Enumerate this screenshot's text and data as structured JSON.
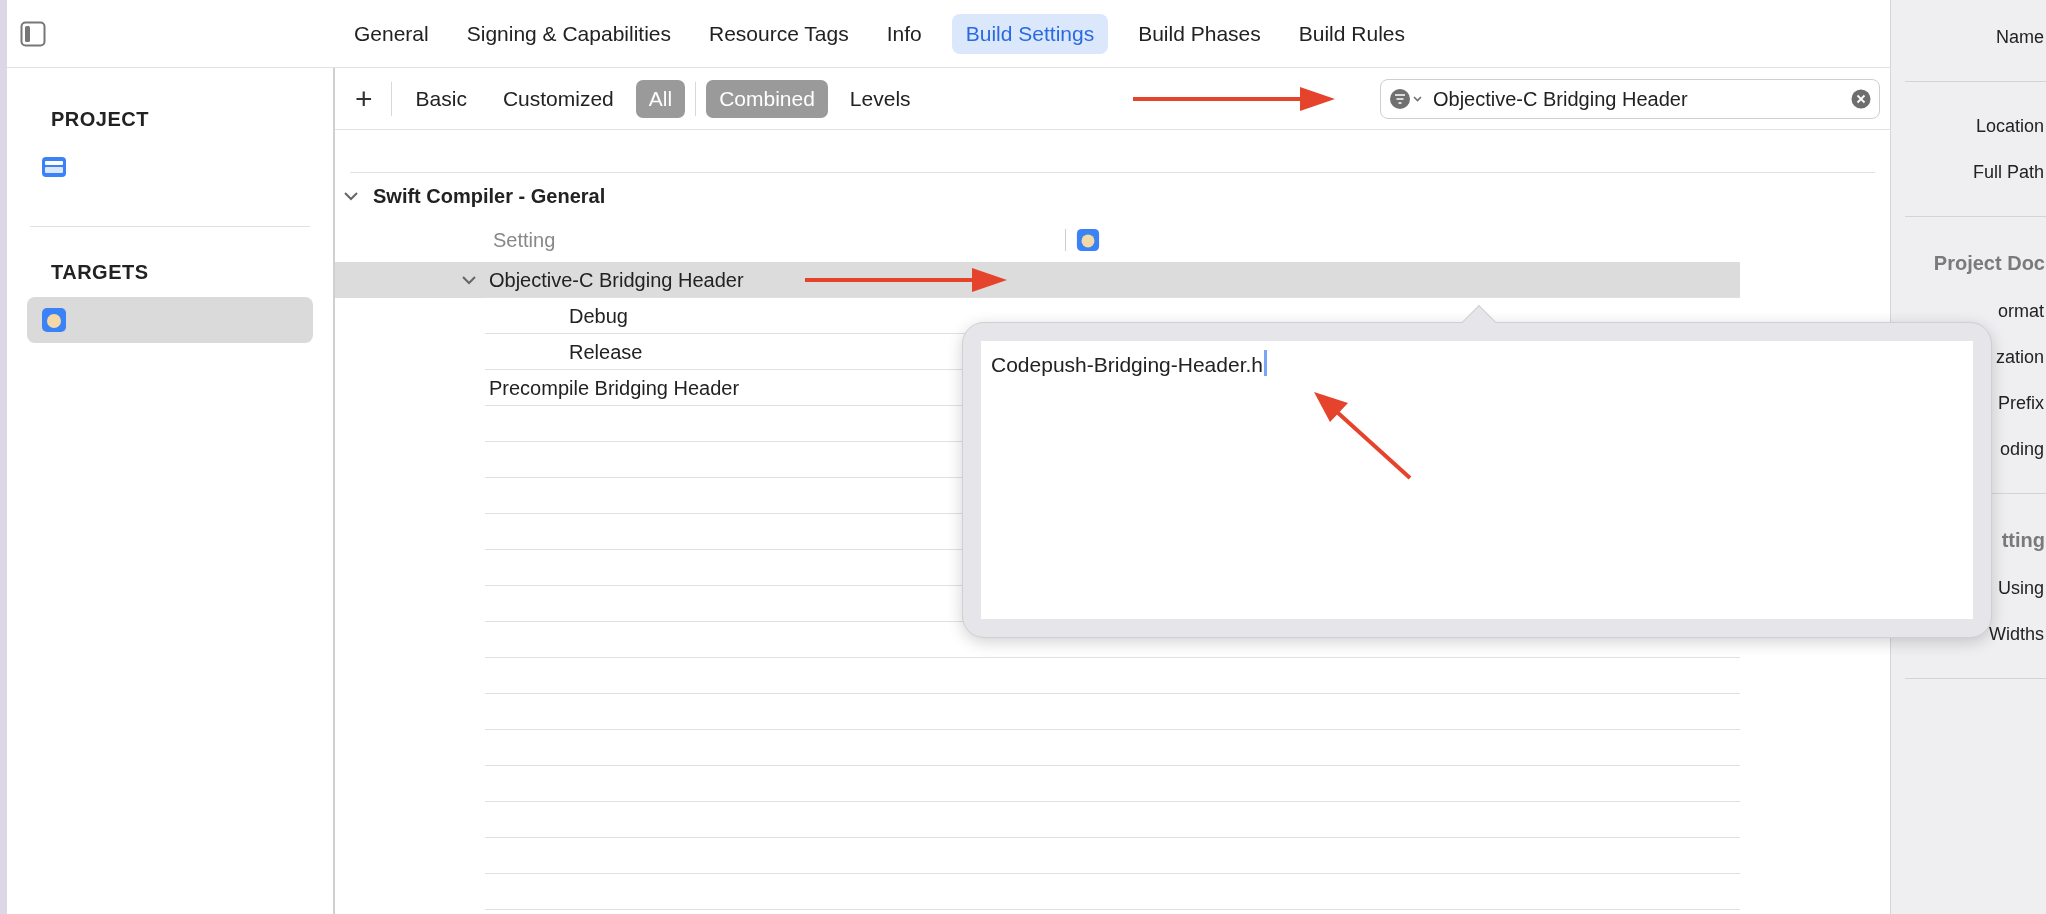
{
  "tabs": [
    {
      "label": "General",
      "selected": false
    },
    {
      "label": "Signing & Capabilities",
      "selected": false
    },
    {
      "label": "Resource Tags",
      "selected": false
    },
    {
      "label": "Info",
      "selected": false
    },
    {
      "label": "Build Settings",
      "selected": true
    },
    {
      "label": "Build Phases",
      "selected": false
    },
    {
      "label": "Build Rules",
      "selected": false
    }
  ],
  "sidebar": {
    "sections": [
      {
        "title": "PROJECT",
        "items": [
          {
            "kind": "project",
            "selected": false
          }
        ]
      },
      {
        "title": "TARGETS",
        "items": [
          {
            "kind": "app",
            "selected": true
          }
        ]
      }
    ]
  },
  "filter_bar": {
    "add_button": "+",
    "scopes": [
      {
        "label": "Basic",
        "selected": false
      },
      {
        "label": "Customized",
        "selected": false
      },
      {
        "label": "All",
        "selected": true
      }
    ],
    "views": [
      {
        "label": "Combined",
        "selected": true
      },
      {
        "label": "Levels",
        "selected": false
      }
    ],
    "search": {
      "value": "Objective-C Bridging Header"
    }
  },
  "table": {
    "section": "Swift Compiler - General",
    "expanded": true,
    "column_header": "Setting",
    "rows": [
      {
        "label": "Objective-C Bridging Header",
        "selected": true,
        "expanded": true,
        "children": [
          {
            "label": "Debug",
            "selected": false
          },
          {
            "label": "Release",
            "selected": false
          }
        ]
      },
      {
        "label": "Precompile Bridging Header",
        "selected": false
      }
    ]
  },
  "popup": {
    "value": "Codepush-Bridging-Header.h"
  },
  "inspector": {
    "items": [
      {
        "kind": "label",
        "text": "Name"
      },
      {
        "kind": "divider"
      },
      {
        "kind": "label",
        "text": "Location"
      },
      {
        "kind": "label",
        "text": "Full Path"
      },
      {
        "kind": "divider"
      },
      {
        "kind": "heading",
        "text": "Project Doc"
      },
      {
        "kind": "label",
        "text": "ormat"
      },
      {
        "kind": "label",
        "text": "zation"
      },
      {
        "kind": "label",
        "text": "Prefix"
      },
      {
        "kind": "label",
        "text": "oding"
      },
      {
        "kind": "divider"
      },
      {
        "kind": "heading",
        "text": "tting"
      },
      {
        "kind": "label",
        "text": "Using"
      },
      {
        "kind": "label",
        "text": "Widths"
      },
      {
        "kind": "divider"
      }
    ]
  }
}
